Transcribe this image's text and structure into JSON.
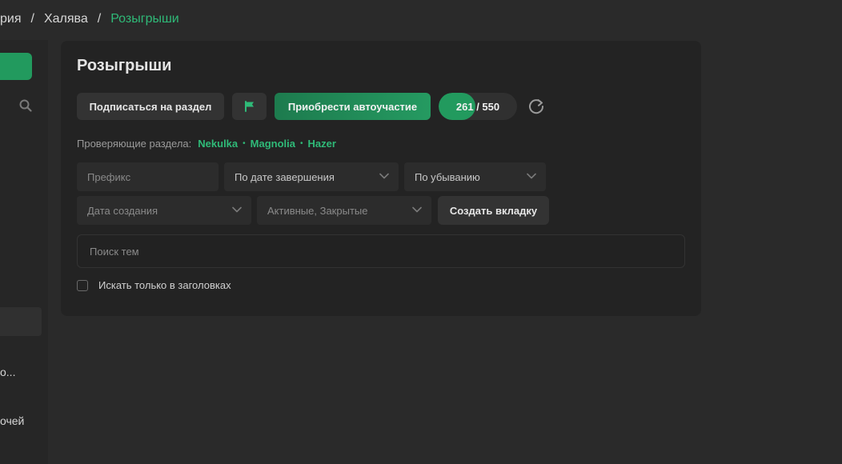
{
  "breadcrumb": {
    "items": [
      "рия",
      "Халява"
    ],
    "separator": "/",
    "current": "Розыгрыши"
  },
  "sidebar": {
    "items": [
      "о...",
      "очей"
    ]
  },
  "panel": {
    "title": "Розыгрыши",
    "subscribe_label": "Подписаться на раздел",
    "flag_icon": "flag-icon",
    "buy_label": "Приобрести автоучастие",
    "counter": {
      "current": 261,
      "total": 550,
      "text": "261 / 550"
    },
    "refresh_icon": "refresh-icon",
    "moderators_label": "Проверяющие раздела:",
    "moderators": [
      "Nekulka",
      "Magnolia",
      "Hazer"
    ],
    "moderator_separator": "•"
  },
  "filters": {
    "prefix_placeholder": "Префикс",
    "sort_value": "По дате завершения",
    "order_value": "По убыванию",
    "date_placeholder": "Дата создания",
    "state_value": "Активные, Закрытые",
    "create_tab_label": "Создать вкладку"
  },
  "search": {
    "placeholder": "Поиск тем",
    "titles_only_label": "Искать только в заголовках",
    "titles_only_checked": false
  },
  "colors": {
    "accent": "#2fba78",
    "button_green": "#229a5e",
    "background": "#2a2a2a",
    "panel": "#232323"
  }
}
